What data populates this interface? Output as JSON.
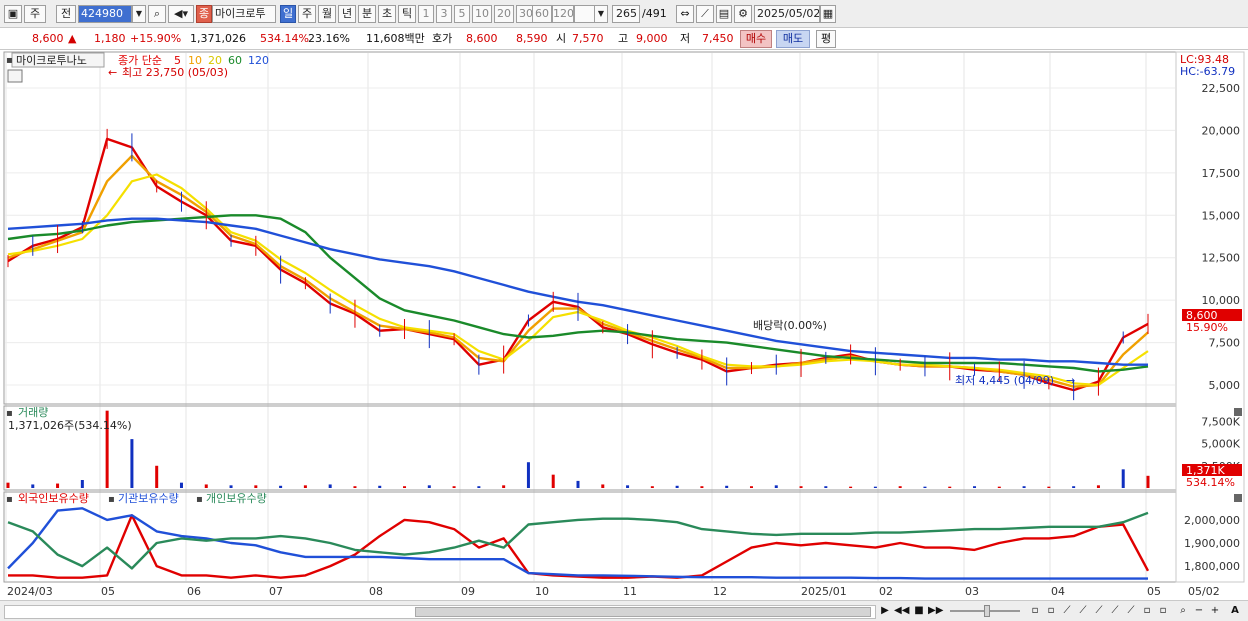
{
  "toolbar": {
    "chart_type": "주",
    "prev_label": "전",
    "stock_code": "424980",
    "stock_name": "마이크로투",
    "badge": "종",
    "periods": [
      "일",
      "주",
      "월",
      "년",
      "분",
      "초",
      "틱"
    ],
    "active_period": "일",
    "intervals": [
      "1",
      "3",
      "5",
      "10",
      "20",
      "30",
      "60",
      "120"
    ],
    "count_current": "265",
    "count_total": "/491",
    "date": "2025/05/02"
  },
  "quote": {
    "price": "8,600",
    "change": "1,180",
    "change_pct": "+15.90%",
    "volume": "1,371,026",
    "volume_ratio": "534.14%",
    "turnover_rate": "23.16%",
    "amount": "11,608백만",
    "ask_label": "호가",
    "ask1": "8,600",
    "ask2": "8,590",
    "open_label": "시",
    "open": "7,570",
    "high_label": "고",
    "high": "9,000",
    "low_label": "저",
    "low": "7,450",
    "buy_label": "매수",
    "sell_label": "매도",
    "eval_label": "평"
  },
  "price_panel": {
    "name_label": "마이크로투나노",
    "legend_prefix": "종가 단순",
    "ma_periods": [
      "5",
      "10",
      "20",
      "60",
      "120"
    ],
    "ma_colors": [
      "#e00000",
      "#f0a000",
      "#f5e000",
      "#1a8a2a",
      "#2050d8"
    ],
    "high_annotation": "최고 23,750 (05/03)",
    "low_annotation": "최저 4,445 (04/09)",
    "dividend_annotation": "배당락(0.00%)",
    "lc": "LC:93.48",
    "hc": "HC:-63.79",
    "y_ticks": [
      "22,500",
      "20,000",
      "17,500",
      "15,000",
      "12,500",
      "10,000",
      "7,500",
      "5,000"
    ],
    "price_tag": "8,600",
    "pct_tag": "15.90%"
  },
  "volume_panel": {
    "title": "거래량",
    "value_label": "1,371,026주(534.14%)",
    "y_ticks": [
      "7,500K",
      "5,000K",
      "2,500K"
    ],
    "tag_value": "1,371K",
    "tag_pct": "534.14%"
  },
  "holding_panel": {
    "legend": [
      "외국인보유수량",
      "기관보유수량",
      "개인보유수량"
    ],
    "legend_colors": [
      "#e00000",
      "#2050d8",
      "#2a8a5a"
    ],
    "y_ticks": [
      "2,000,000",
      "1,900,000",
      "1,800,000"
    ]
  },
  "x_axis": {
    "labels": [
      "2024/03",
      "05",
      "06",
      "07",
      "08",
      "09",
      "10",
      "11",
      "12",
      "2025/01",
      "02",
      "03",
      "04",
      "05"
    ],
    "right_label": "05/02"
  },
  "chart_data": [
    {
      "type": "line",
      "title": "",
      "ylim": [
        4000,
        24500
      ],
      "x_labels": [
        "2024/03",
        "05",
        "06",
        "07",
        "08",
        "09",
        "10",
        "11",
        "12",
        "2025/01",
        "02",
        "03",
        "04",
        "05"
      ],
      "series": [
        {
          "name": "5",
          "values": [
            12300,
            13200,
            13600,
            14300,
            19500,
            19000,
            16700,
            15800,
            15000,
            13500,
            13200,
            11800,
            11000,
            9800,
            9200,
            8200,
            8300,
            8000,
            7700,
            6200,
            6500,
            8800,
            9900,
            9600,
            8400,
            8000,
            7400,
            6900,
            6500,
            5800,
            6000,
            6200,
            6300,
            6600,
            6800,
            6400,
            6200,
            6100,
            6100,
            5900,
            5800,
            5600,
            5100,
            4700,
            5200,
            7800,
            8600
          ]
        },
        {
          "name": "10",
          "values": [
            12500,
            13000,
            13500,
            14000,
            17000,
            18500,
            17000,
            16200,
            15200,
            13800,
            13300,
            12000,
            11200,
            10100,
            9300,
            8500,
            8300,
            8100,
            7800,
            6600,
            6400,
            8200,
            9500,
            9500,
            8600,
            8100,
            7600,
            7100,
            6600,
            6000,
            6000,
            6100,
            6300,
            6500,
            6700,
            6400,
            6200,
            6100,
            6100,
            6000,
            5800,
            5600,
            5300,
            4900,
            5000,
            6800,
            8100
          ]
        },
        {
          "name": "20",
          "values": [
            12700,
            12900,
            13200,
            13600,
            15000,
            17000,
            17400,
            16600,
            15400,
            14000,
            13500,
            12400,
            11600,
            10600,
            9700,
            8900,
            8400,
            8200,
            8000,
            7000,
            6500,
            7600,
            9000,
            9300,
            8800,
            8200,
            7800,
            7300,
            6700,
            6200,
            6100,
            6100,
            6200,
            6400,
            6500,
            6400,
            6200,
            6200,
            6100,
            6000,
            5900,
            5700,
            5500,
            5100,
            5000,
            6000,
            7000
          ]
        },
        {
          "name": "60",
          "values": [
            13600,
            13800,
            13900,
            14100,
            14400,
            14600,
            14700,
            14800,
            14900,
            15000,
            15000,
            14800,
            14000,
            12500,
            11300,
            10100,
            9400,
            9100,
            8800,
            8400,
            8000,
            7800,
            7900,
            8100,
            8200,
            8100,
            7900,
            7700,
            7600,
            7500,
            7300,
            7100,
            6900,
            6700,
            6600,
            6500,
            6400,
            6300,
            6300,
            6300,
            6300,
            6200,
            6100,
            6000,
            5800,
            5900,
            6100
          ]
        },
        {
          "name": "120",
          "values": [
            14200,
            14300,
            14400,
            14500,
            14700,
            14800,
            14800,
            14700,
            14600,
            14400,
            14200,
            13800,
            13400,
            13000,
            12700,
            12400,
            12200,
            12000,
            11700,
            11300,
            10900,
            10500,
            10200,
            9900,
            9700,
            9400,
            9100,
            8800,
            8500,
            8200,
            7900,
            7600,
            7400,
            7200,
            7000,
            6900,
            6800,
            6700,
            6600,
            6600,
            6500,
            6500,
            6400,
            6400,
            6300,
            6200,
            6200
          ]
        }
      ]
    },
    {
      "type": "bar",
      "title": "거래량",
      "ylim": [
        0,
        9000000
      ],
      "x_labels": [
        "2024/03",
        "05",
        "06",
        "07",
        "08",
        "09",
        "10",
        "11",
        "12",
        "2025/01",
        "02",
        "03",
        "04",
        "05"
      ],
      "series": [
        {
          "name": "거래량",
          "values": [
            600000,
            400000,
            500000,
            900000,
            8700000,
            5500000,
            2500000,
            600000,
            400000,
            300000,
            300000,
            250000,
            300000,
            400000,
            200000,
            250000,
            200000,
            300000,
            200000,
            200000,
            300000,
            2900000,
            1500000,
            800000,
            400000,
            300000,
            200000,
            250000,
            200000,
            250000,
            200000,
            300000,
            200000,
            200000,
            150000,
            150000,
            200000,
            150000,
            150000,
            200000,
            150000,
            200000,
            150000,
            200000,
            300000,
            2100000,
            1371026
          ]
        }
      ]
    },
    {
      "type": "line",
      "title": "",
      "ylim": [
        1740000,
        2060000
      ],
      "x_labels": [
        "2024/03",
        "05",
        "06",
        "07",
        "08",
        "09",
        "10",
        "11",
        "12",
        "2025/01",
        "02",
        "03",
        "04",
        "05"
      ],
      "series": [
        {
          "name": "외국인보유수량",
          "values": [
            1760000,
            1760000,
            1750000,
            1750000,
            1760000,
            2020000,
            1800000,
            1760000,
            1760000,
            1750000,
            1760000,
            1750000,
            1760000,
            1800000,
            1850000,
            1930000,
            2000000,
            1990000,
            1960000,
            1880000,
            1920000,
            1770000,
            1760000,
            1755000,
            1750000,
            1750000,
            1755000,
            1750000,
            1760000,
            1820000,
            1880000,
            1900000,
            1890000,
            1900000,
            1890000,
            1880000,
            1900000,
            1880000,
            1880000,
            1870000,
            1900000,
            1920000,
            1920000,
            1930000,
            1970000,
            1980000,
            1780000
          ]
        },
        {
          "name": "기관보유수량",
          "values": [
            1790000,
            1900000,
            2040000,
            2050000,
            2000000,
            2020000,
            1950000,
            1930000,
            1920000,
            1900000,
            1890000,
            1860000,
            1840000,
            1840000,
            1840000,
            1840000,
            1835000,
            1830000,
            1830000,
            1830000,
            1830000,
            1770000,
            1765000,
            1760000,
            1760000,
            1758000,
            1756000,
            1754000,
            1752000,
            1752000,
            1752000,
            1750000,
            1750000,
            1750000,
            1750000,
            1748000,
            1748000,
            1746000,
            1746000,
            1746000,
            1746000,
            1746000,
            1746000,
            1746000,
            1746000,
            1746000,
            1746000
          ]
        },
        {
          "name": "개인보유수량",
          "values": [
            1990000,
            1950000,
            1850000,
            1800000,
            1880000,
            1790000,
            1900000,
            1920000,
            1910000,
            1920000,
            1920000,
            1930000,
            1920000,
            1900000,
            1870000,
            1860000,
            1850000,
            1860000,
            1880000,
            1910000,
            1880000,
            1980000,
            1990000,
            2000000,
            2005000,
            2005000,
            2000000,
            1990000,
            1960000,
            1950000,
            1940000,
            1935000,
            1940000,
            1940000,
            1940000,
            1945000,
            1945000,
            1950000,
            1955000,
            1960000,
            1960000,
            1965000,
            1970000,
            1970000,
            1970000,
            1990000,
            2030000
          ]
        }
      ]
    }
  ]
}
